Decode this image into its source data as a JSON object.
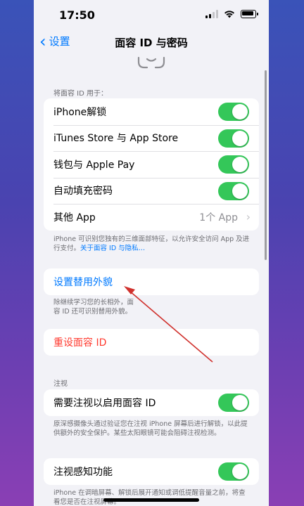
{
  "status_bar": {
    "time": "17:50"
  },
  "nav": {
    "back_label": "设置",
    "title": "面容 ID 与密码"
  },
  "use_section": {
    "header": "将面容 ID 用于：",
    "rows": [
      {
        "label": "iPhone解锁",
        "toggle": true
      },
      {
        "label": "iTunes Store 与 App Store",
        "toggle": true
      },
      {
        "label": "钱包与 Apple Pay",
        "toggle": true
      },
      {
        "label": "自动填充密码",
        "toggle": true
      },
      {
        "label": "其他 App",
        "value": "1个 App"
      }
    ],
    "footnote_text": "iPhone 可识别您独有的三维面部特征，以允许安全访问 App 及进行支付。",
    "footnote_link": "关于面容 ID 与隐私…"
  },
  "alternate": {
    "label": "设置替用外貌",
    "footnote": "除继续学习您的长相外，面容 ID 还可识别替用外貌。"
  },
  "reset": {
    "label": "重设面容 ID"
  },
  "attention_section": {
    "header": "注视",
    "require_label": "需要注视以启用面容 ID",
    "require_toggle": true,
    "require_footnote": "原深感摄像头通过验证您在注视 iPhone 屏幕后进行解锁，以此提供额外的安全保护。某些太阳眼镜可能会阻碍注视检测。",
    "aware_label": "注视感知功能",
    "aware_toggle": true,
    "aware_footnote": "iPhone 在调暗屏幕、解锁后展开通知或调低提醒音量之前，将查看您是否在注视屏幕。"
  },
  "colors": {
    "accent": "#007aff",
    "toggle_on": "#34c759",
    "destructive": "#ff3b30",
    "annotation": "#d0312d"
  }
}
